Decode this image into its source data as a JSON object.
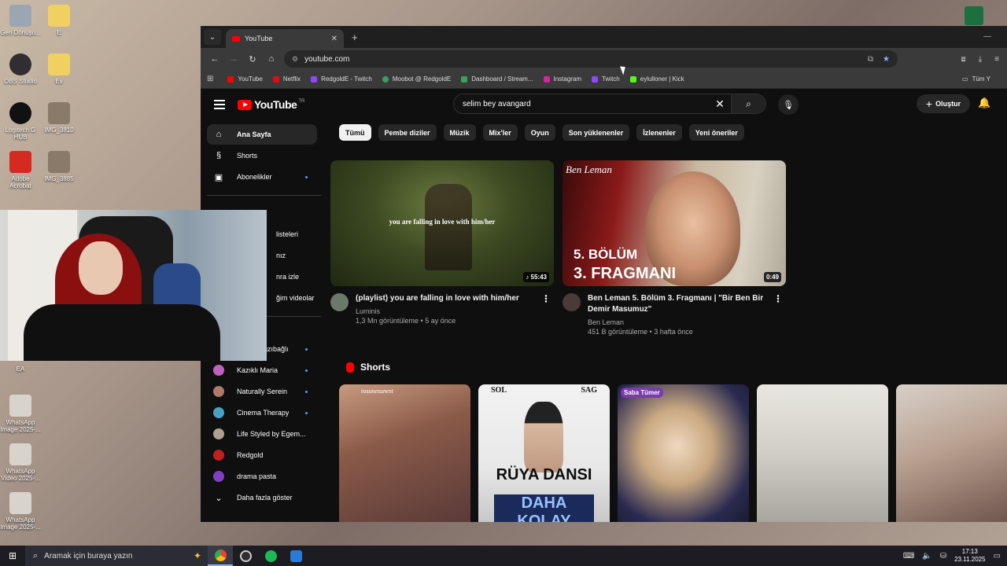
{
  "desktop": {
    "icons": [
      {
        "label": "Geri Dönüşü...",
        "color": "#9aa7b3"
      },
      {
        "label": "E",
        "color": "#f0d060"
      },
      {
        "label": "OBS Studio",
        "color": "#302e31"
      },
      {
        "label": "Ev",
        "color": "#f0d060"
      },
      {
        "label": "Logitech G HUB",
        "color": "#111111"
      },
      {
        "label": "IMG_3810",
        "color": "#8a7a6a"
      },
      {
        "label": "Adobe Acrobat",
        "color": "#d42a20"
      },
      {
        "label": "IMG_3885",
        "color": "#8a7a6a"
      },
      {
        "label": "EA",
        "color": "#e84020"
      },
      {
        "label": "WhatsApp Image 2025-...",
        "color": "#d8d4cc"
      },
      {
        "label": "WhatsApp Video 2025-...",
        "color": "#d8d4cc"
      },
      {
        "label": "WhatsApp Image 2025-...",
        "color": "#d8d4cc"
      }
    ]
  },
  "browser": {
    "tab_title": "YouTube",
    "url": "youtube.com",
    "bookmarks": [
      {
        "label": "YouTube",
        "color": "#ff0000"
      },
      {
        "label": "Netflix",
        "color": "#e50914"
      },
      {
        "label": "RedgoldE - Twitch",
        "color": "#9146ff"
      },
      {
        "label": "Moobot @ RedgoldE",
        "color": "#3aa05a"
      },
      {
        "label": "Dashboard / Stream...",
        "color": "#3aa05a"
      },
      {
        "label": "Instagram",
        "color": "#d6249f"
      },
      {
        "label": "Twitch",
        "color": "#9146ff"
      },
      {
        "label": "eylulloner | Kick",
        "color": "#53fc18"
      }
    ],
    "bookmarks_right": "Tüm Y"
  },
  "youtube": {
    "logo_text": "YouTube",
    "country": "TR",
    "search_query": "selim bey avangard",
    "create_label": "Oluştur",
    "sidebar": {
      "main": [
        {
          "label": "Ana Sayfa",
          "icon": "home-icon",
          "glyph": "⌂"
        },
        {
          "label": "Shorts",
          "icon": "shorts-icon",
          "glyph": "§"
        },
        {
          "label": "Abonelikler",
          "icon": "subscriptions-icon",
          "glyph": "▣"
        }
      ],
      "you_partial": [
        {
          "label": "listeleri"
        },
        {
          "label": "nız"
        },
        {
          "label": "nra izle"
        },
        {
          "label": "ğim videolar"
        }
      ],
      "subscriptions": [
        {
          "label": "Raşit Bağzıbağlı",
          "color": "#8a6a5a"
        },
        {
          "label": "Kazıklı Maria",
          "color": "#c060c0"
        },
        {
          "label": "Naturally Serein",
          "color": "#b07a6a"
        },
        {
          "label": "Cinema Therapy",
          "color": "#4aa0c0"
        },
        {
          "label": "Life Styled by Egem...",
          "color": "#b0a090"
        },
        {
          "label": "Redgold",
          "color": "#c02020"
        },
        {
          "label": "drama pasta",
          "color": "#8040c0"
        }
      ],
      "more_label": "Daha fazla göster"
    },
    "chips": [
      "Tümü",
      "Pembe diziler",
      "Müzik",
      "Mix'ler",
      "Oyun",
      "Son yüklenenler",
      "İzlenenler",
      "Yeni öneriler"
    ],
    "videos": [
      {
        "title": "(playlist) you are falling in love with him/her",
        "channel": "Luminis",
        "stats": "1,3 Mn görüntüleme • 5 ay önce",
        "duration": "55:43",
        "overlay": "you are falling in love with him/her",
        "avatar_color": "#6a7a6a"
      },
      {
        "title": "Ben Leman 5. Bölüm 3. Fragmanı | \"Bir Ben Bir Demir Masumuz\"",
        "channel": "Ben Leman",
        "stats": "451 B görüntüleme • 3 hafta önce",
        "duration": "0:49",
        "brand": "Ben Leman",
        "line1": "5. BÖLÜM",
        "line2": "3. FRAGMANI",
        "avatar_color": "#4a3a3a"
      }
    ],
    "shorts_title": "Shorts",
    "shorts": [
      {
        "brand": "tusunesunest"
      },
      {
        "sol": "SOL",
        "sag": "SAG",
        "line1": "RÜYA DANSI",
        "line2": "DAHA KOLAY"
      },
      {
        "badge": "Saba Tümer"
      },
      {},
      {}
    ]
  },
  "taskbar": {
    "search_placeholder": "Aramak için buraya yazın",
    "time": "17:13",
    "date": "23.11.2025"
  }
}
